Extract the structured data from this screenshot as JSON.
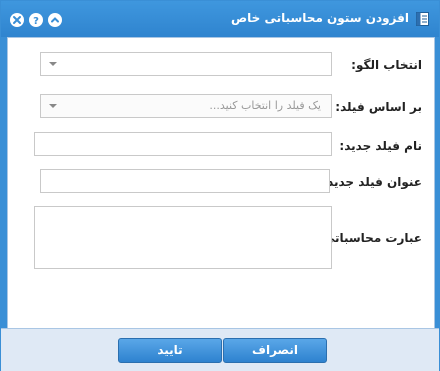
{
  "dialog": {
    "title": "افزودن ستون محاسباتی خاص",
    "title_icon": "document-icon",
    "window_buttons": [
      "close-icon",
      "help-icon",
      "collapse-icon"
    ]
  },
  "form": {
    "template_label": "انتخاب الگو:",
    "template_value": "",
    "based_on_label": "بر اساس فیلد:",
    "based_on_placeholder": "یک فیلد را انتخاب کنید...",
    "new_field_name_label": "نام فیلد جدید:",
    "new_field_name_value": "",
    "new_field_title_label": "عنوان فیلد جدید:",
    "new_field_title_value": "",
    "expression_label": "عبارت محاسباتی:",
    "expression_value": ""
  },
  "footer": {
    "confirm_label": "تایید",
    "cancel_label": "انصراف"
  },
  "colors": {
    "titlebar": "#3a8fd6",
    "button": "#3a8fd6"
  }
}
